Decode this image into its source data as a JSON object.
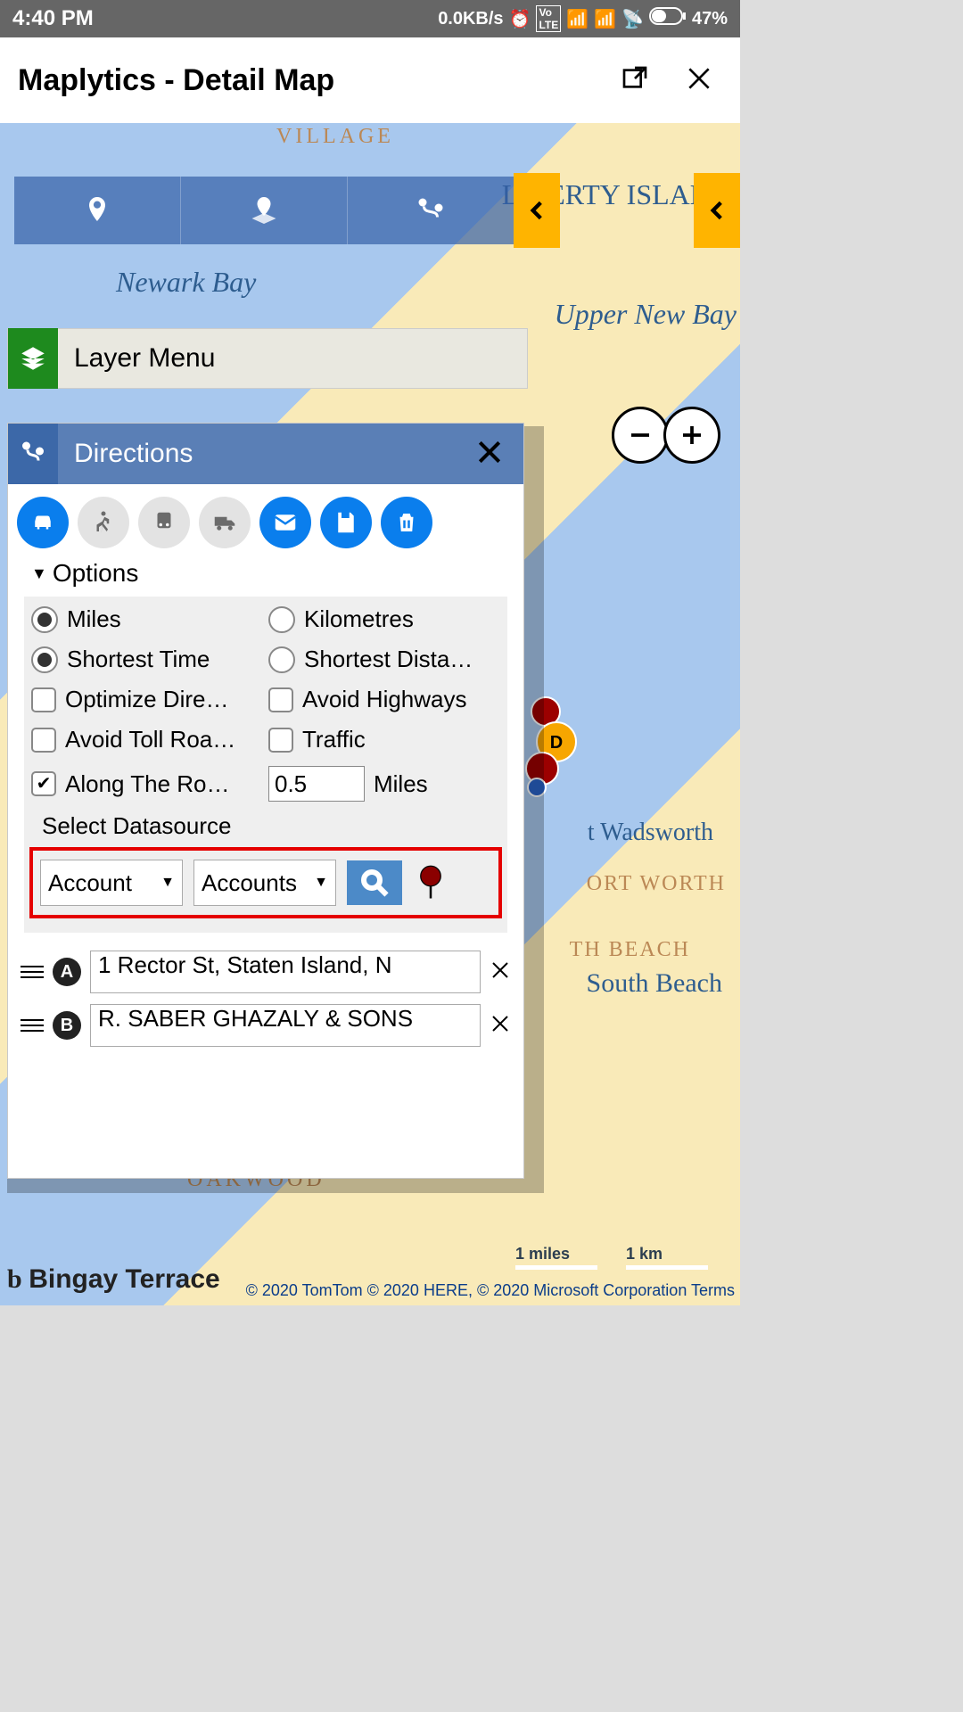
{
  "statusbar": {
    "time": "4:40 PM",
    "traffic": "0.0KB/s",
    "battery": "47%"
  },
  "header": {
    "title": "Maplytics - Detail Map"
  },
  "map": {
    "labels": {
      "village": "VILLAGE",
      "liberty": "LIBERTY ISLAND",
      "newark_bay": "Newark Bay",
      "upper_bay": "Upper New Bay",
      "wadsworth": "t Wadsworth",
      "ort_worth": "ORT WORTH",
      "th_beach": "TH BEACH",
      "south_beach": "South Beach",
      "oakwood": "OAKWOOD",
      "bay_terrace": "Bingay Terrace"
    }
  },
  "layer_menu": {
    "title": "Layer Menu"
  },
  "directions": {
    "title": "Directions",
    "options_label": "Options",
    "unit_miles": "Miles",
    "unit_km": "Kilometres",
    "shortest_time": "Shortest Time",
    "shortest_dist": "Shortest Dista…",
    "optimize": "Optimize Dire…",
    "avoid_hwy": "Avoid Highways",
    "avoid_toll": "Avoid Toll Roa…",
    "traffic": "Traffic",
    "along_route": "Along The Ro…",
    "radius_value": "0.5",
    "radius_unit": "Miles",
    "datasource_label": "Select Datasource",
    "ds1": "Account",
    "ds2": "Accounts",
    "waypoints": [
      {
        "label": "A",
        "value": "1 Rector St, Staten Island, N"
      },
      {
        "label": "B",
        "value": "R. SABER GHAZALY & SONS"
      }
    ]
  },
  "scale": {
    "miles": "1 miles",
    "km": "1 km"
  },
  "attribution": "© 2020 TomTom © 2020 HERE, © 2020 Microsoft Corporation  Terms"
}
